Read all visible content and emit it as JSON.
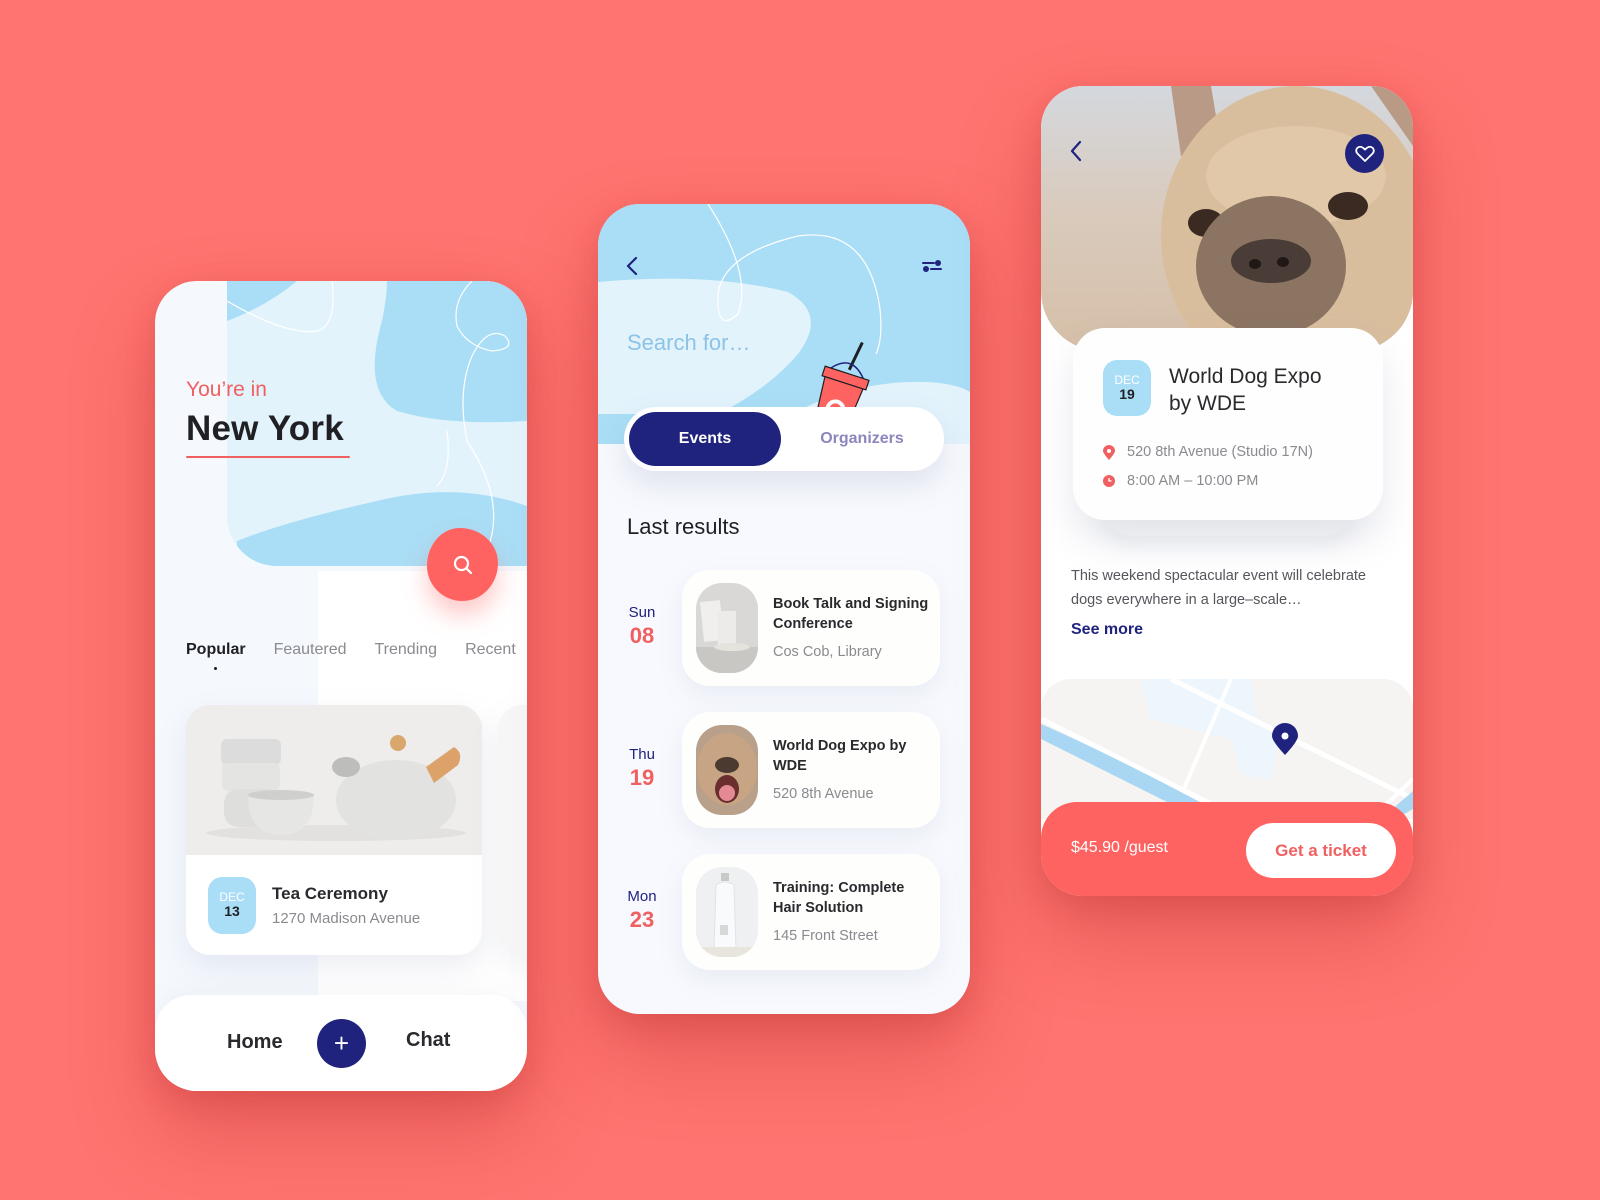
{
  "colors": {
    "background": "#FF7470",
    "accent_red": "#FF6361",
    "navy": "#1F237D",
    "light_blue": "#A9DEF6"
  },
  "home_screen": {
    "location_label": "You’re in",
    "city": "New York",
    "search_icon": "search-icon",
    "tabs": [
      {
        "label": "Popular",
        "active": true
      },
      {
        "label": "Feautered",
        "active": false
      },
      {
        "label": "Trending",
        "active": false
      },
      {
        "label": "Recent",
        "active": false
      }
    ],
    "featured_event": {
      "month": "DEC",
      "day": "13",
      "title": "Tea Ceremony",
      "address": "1270 Madison Avenue",
      "image": "teapot-and-cups-photo"
    },
    "bottom_nav": {
      "home": "Home",
      "add": "+",
      "chat": "Chat"
    }
  },
  "search_screen": {
    "back_icon": "chevron-left-icon",
    "filter_icon": "filter-sliders-icon",
    "search_placeholder": "Search for…",
    "segments": [
      {
        "label": "Events",
        "active": true
      },
      {
        "label": "Organizers",
        "active": false
      }
    ],
    "section_title": "Last results",
    "results": [
      {
        "dow": "Sun",
        "day": "08",
        "title": "Book Talk and Signing Conference",
        "location": "Cos Cob, Library",
        "image": "books-photo"
      },
      {
        "dow": "Thu",
        "day": "19",
        "title": "World Dog Expo by WDE",
        "location": "520 8th Avenue",
        "image": "yawning-dog-photo"
      },
      {
        "dow": "Mon",
        "day": "23",
        "title": "Training: Complete Hair Solution",
        "location": "145 Front Street",
        "image": "bottle-photo"
      }
    ]
  },
  "detail_screen": {
    "back_icon": "chevron-left-icon",
    "favorite_icon": "heart-icon",
    "image": "french-bulldog-photo",
    "month": "DEC",
    "day": "19",
    "title_line1": "World Dog Expo",
    "title_line2": "by WDE",
    "address": "520 8th Avenue (Studio 17N)",
    "hours": "8:00 AM – 10:00 PM",
    "description": "This weekend spectacular event will celebrate dogs everywhere in a large–scale…",
    "see_more": "See more",
    "price": "$45.90 /guest",
    "cta": "Get a ticket"
  }
}
